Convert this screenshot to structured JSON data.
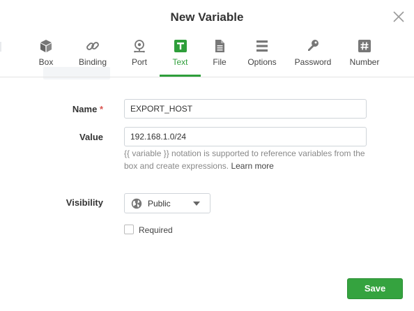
{
  "dialog": {
    "title": "New Variable"
  },
  "tabs": [
    {
      "label": "Box",
      "icon": "cube-icon",
      "active": false
    },
    {
      "label": "Binding",
      "icon": "link-icon",
      "active": false
    },
    {
      "label": "Port",
      "icon": "network-port-icon",
      "active": false
    },
    {
      "label": "Text",
      "icon": "text-icon",
      "active": true
    },
    {
      "label": "File",
      "icon": "file-icon",
      "active": false
    },
    {
      "label": "Options",
      "icon": "list-icon",
      "active": false
    },
    {
      "label": "Password",
      "icon": "key-icon",
      "active": false
    },
    {
      "label": "Number",
      "icon": "hash-icon",
      "active": false
    }
  ],
  "form": {
    "name_label": "Name",
    "required_marker": "*",
    "name_value": "EXPORT_HOST",
    "value_label": "Value",
    "value_value": "192.168.1.0/24",
    "help_text": "{{ variable }} notation is supported to reference variables from the box and create expressions.",
    "help_link": "Learn more",
    "visibility_label": "Visibility",
    "visibility_value": "Public",
    "required_label": "Required",
    "required_checked": false
  },
  "actions": {
    "save_label": "Save"
  },
  "colors": {
    "accent": "#2e9e3a",
    "save_button": "#35a33f",
    "required_marker": "#d9534f"
  }
}
